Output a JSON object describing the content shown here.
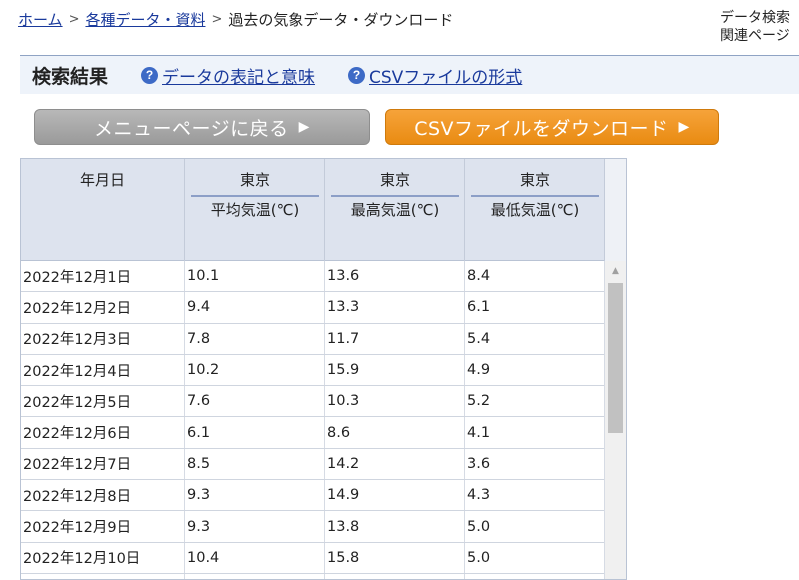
{
  "breadcrumb": {
    "home": "ホーム",
    "data": "各種データ・資料",
    "current": "過去の気象データ・ダウンロード",
    "sep1": ">",
    "sep2": ">"
  },
  "side_links": {
    "data_search": "データ検索",
    "related_pages": "関連ページ"
  },
  "results": {
    "title": "検索結果",
    "help_notation": "データの表記と意味",
    "help_csv_format": "CSVファイルの形式",
    "help_icon_glyph": "?"
  },
  "buttons": {
    "back": "メニューページに戻る",
    "download_csv": "CSVファイルをダウンロード",
    "arrow": "▶"
  },
  "table": {
    "date_header": "年月日",
    "columns": [
      {
        "station": "東京",
        "element": "平均気温(℃)"
      },
      {
        "station": "東京",
        "element": "最高気温(℃)"
      },
      {
        "station": "東京",
        "element": "最低気温(℃)"
      }
    ],
    "rows": [
      {
        "date": "2022年12月1日",
        "avg": "10.1",
        "max": "13.6",
        "min": "8.4"
      },
      {
        "date": "2022年12月2日",
        "avg": "9.4",
        "max": "13.3",
        "min": "6.1"
      },
      {
        "date": "2022年12月3日",
        "avg": "7.8",
        "max": "11.7",
        "min": "5.4"
      },
      {
        "date": "2022年12月4日",
        "avg": "10.2",
        "max": "15.9",
        "min": "4.9"
      },
      {
        "date": "2022年12月5日",
        "avg": "7.6",
        "max": "10.3",
        "min": "5.2"
      },
      {
        "date": "2022年12月6日",
        "avg": "6.1",
        "max": "8.6",
        "min": "4.1"
      },
      {
        "date": "2022年12月7日",
        "avg": "8.5",
        "max": "14.2",
        "min": "3.6"
      },
      {
        "date": "2022年12月8日",
        "avg": "9.3",
        "max": "14.9",
        "min": "4.3"
      },
      {
        "date": "2022年12月9日",
        "avg": "9.3",
        "max": "13.8",
        "min": "5.0"
      },
      {
        "date": "2022年12月10日",
        "avg": "10.4",
        "max": "15.8",
        "min": "5.0"
      }
    ]
  },
  "scrollbar": {
    "up_arrow": "▲"
  },
  "colors": {
    "link": "#1a3a9c",
    "header_bg": "#dde3ee",
    "results_bar_bg": "#eef3fa",
    "button_gray": "#a8a8a8",
    "button_orange": "#f0961f",
    "help_icon": "#3d6ac6"
  }
}
